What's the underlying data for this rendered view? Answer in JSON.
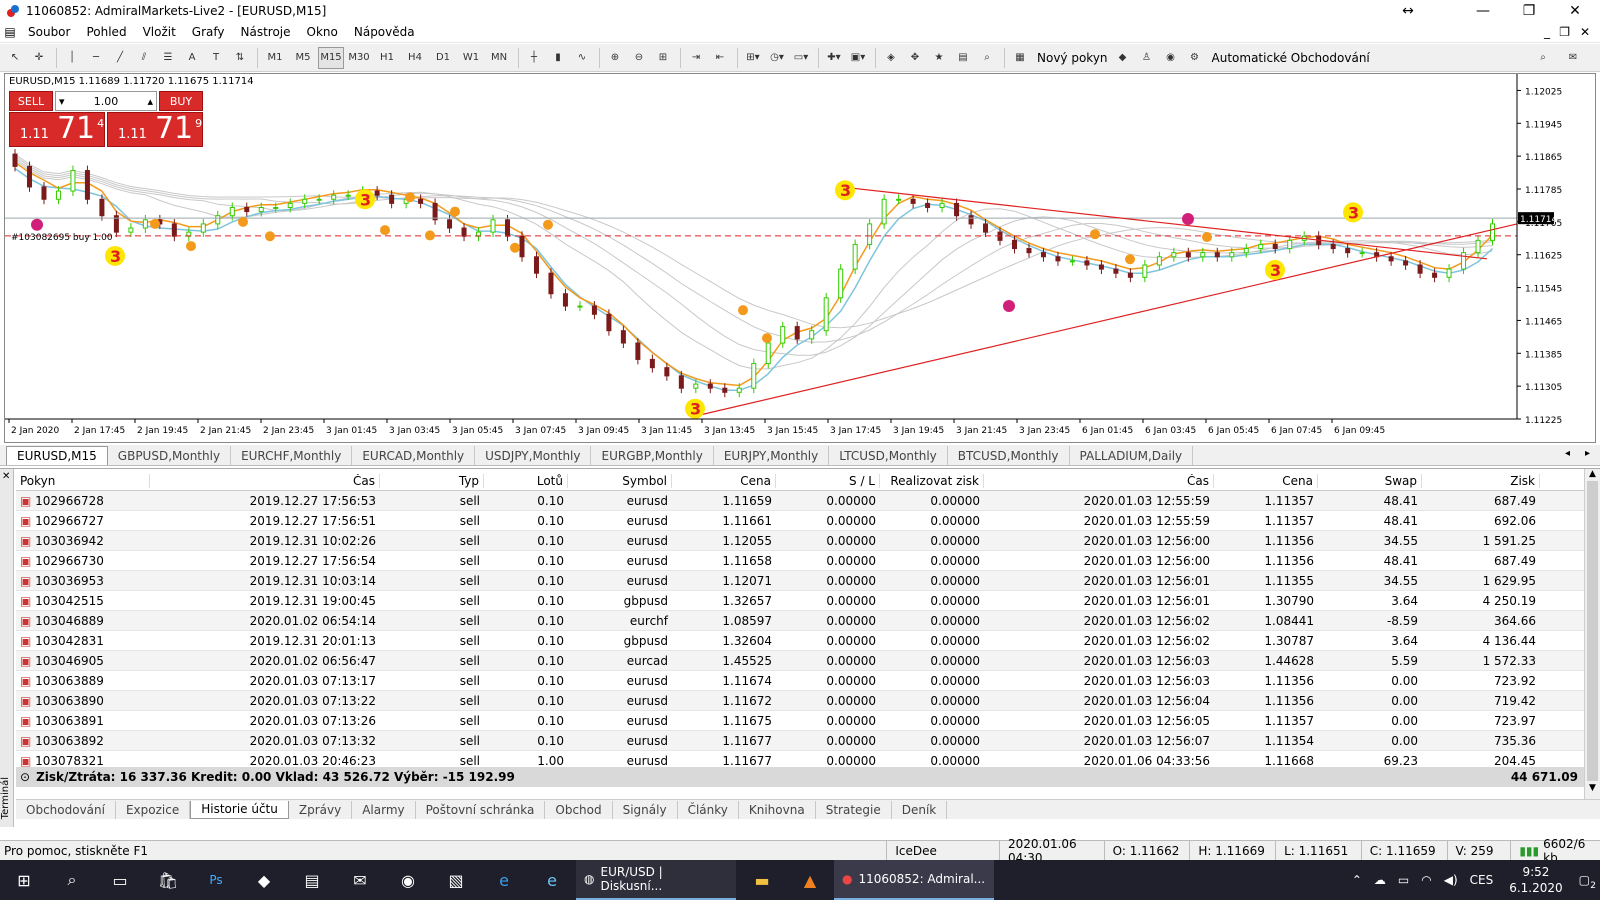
{
  "window": {
    "title": "11060852: AdmiralMarkets-Live2 - [EURUSD,M15]"
  },
  "menu": [
    "Soubor",
    "Pohled",
    "Vložit",
    "Grafy",
    "Nástroje",
    "Okno",
    "Nápověda"
  ],
  "toolbar": {
    "timeframes": [
      "M1",
      "M5",
      "M15",
      "M30",
      "H1",
      "H4",
      "D1",
      "W1",
      "MN"
    ],
    "new_order": "Nový pokyn",
    "auto_trading": "Automatické Obchodování"
  },
  "chart": {
    "info": "EURUSD,M15  1.11689 1.11720 1.11675 1.11714",
    "sell_label": "SELL",
    "buy_label": "BUY",
    "lot": "1.00",
    "sell_price": {
      "small": "1.11",
      "big": "71",
      "sup": "4"
    },
    "buy_price": {
      "small": "1.11",
      "big": "71",
      "sup": "9"
    },
    "order_line_label": "#103082695 buy 1.00",
    "current_price_label": "1.11714",
    "price_levels": [
      "1.12025",
      "1.11945",
      "1.11865",
      "1.11785",
      "1.11705",
      "1.11625",
      "1.11545",
      "1.11465",
      "1.11385",
      "1.11305",
      "1.11225"
    ],
    "time_labels": [
      "2 Jan 2020",
      "2 Jan 17:45",
      "2 Jan 19:45",
      "2 Jan 21:45",
      "2 Jan 23:45",
      "3 Jan 01:45",
      "3 Jan 03:45",
      "3 Jan 05:45",
      "3 Jan 07:45",
      "3 Jan 09:45",
      "3 Jan 11:45",
      "3 Jan 13:45",
      "3 Jan 15:45",
      "3 Jan 17:45",
      "3 Jan 19:45",
      "3 Jan 21:45",
      "3 Jan 23:45",
      "6 Jan 01:45",
      "6 Jan 03:45",
      "6 Jan 05:45",
      "6 Jan 07:45",
      "6 Jan 09:45"
    ]
  },
  "chart_data": {
    "type": "line",
    "ylim": [
      1.11225,
      1.12065
    ],
    "close": [
      1.1184,
      1.1179,
      1.1176,
      1.1178,
      1.1183,
      1.1176,
      1.1172,
      1.1168,
      1.1169,
      1.1171,
      1.117,
      1.1167,
      1.1168,
      1.117,
      1.1172,
      1.1174,
      1.1173,
      1.1174,
      1.1174,
      1.1175,
      1.1176,
      1.1176,
      1.1177,
      1.1177,
      1.1178,
      1.1177,
      1.1175,
      1.1176,
      1.1175,
      1.1171,
      1.1169,
      1.1167,
      1.1168,
      1.1171,
      1.1167,
      1.1162,
      1.1158,
      1.1153,
      1.115,
      1.115,
      1.1148,
      1.1144,
      1.1141,
      1.1137,
      1.1135,
      1.1133,
      1.113,
      1.1131,
      1.113,
      1.1129,
      1.113,
      1.1136,
      1.1141,
      1.1145,
      1.1142,
      1.1144,
      1.1152,
      1.1159,
      1.1165,
      1.117,
      1.1176,
      1.1176,
      1.1175,
      1.1174,
      1.1175,
      1.1172,
      1.117,
      1.1168,
      1.1166,
      1.1164,
      1.1163,
      1.1162,
      1.1161,
      1.1161,
      1.116,
      1.1159,
      1.1158,
      1.1157,
      1.116,
      1.1162,
      1.1163,
      1.1162,
      1.1163,
      1.1162,
      1.1163,
      1.1164,
      1.1165,
      1.1164,
      1.1166,
      1.1167,
      1.1165,
      1.1164,
      1.1163,
      1.1163,
      1.1162,
      1.1161,
      1.116,
      1.1158,
      1.1157,
      1.1159,
      1.1163,
      1.1166,
      1.117
    ],
    "resistance_line": {
      "from": [
        1.1179
      ],
      "to": [
        1.11615
      ]
    },
    "support_line": {
      "from": [
        1.11232
      ],
      "to": [
        1.117
      ]
    }
  },
  "symbol_tabs": [
    "EURUSD,M15",
    "GBPUSD,Monthly",
    "EURCHF,Monthly",
    "EURCAD,Monthly",
    "USDJPY,Monthly",
    "EURGBP,Monthly",
    "EURJPY,Monthly",
    "LTCUSD,Monthly",
    "BTCUSD,Monthly",
    "PALLADIUM,Daily"
  ],
  "history": {
    "columns": [
      "Pokyn",
      "Čas",
      "Typ",
      "Lotů",
      "Symbol",
      "Cena",
      "S / L",
      "Realizovat zisk",
      "Čas",
      "Cena",
      "Swap",
      "Zisk"
    ],
    "rows": [
      [
        "102966728",
        "2019.12.27 17:56:53",
        "sell",
        "0.10",
        "eurusd",
        "1.11659",
        "0.00000",
        "0.00000",
        "2020.01.03 12:55:59",
        "1.11357",
        "48.41",
        "687.49"
      ],
      [
        "102966727",
        "2019.12.27 17:56:51",
        "sell",
        "0.10",
        "eurusd",
        "1.11661",
        "0.00000",
        "0.00000",
        "2020.01.03 12:55:59",
        "1.11357",
        "48.41",
        "692.06"
      ],
      [
        "103036942",
        "2019.12.31 10:02:26",
        "sell",
        "0.10",
        "eurusd",
        "1.12055",
        "0.00000",
        "0.00000",
        "2020.01.03 12:56:00",
        "1.11356",
        "34.55",
        "1 591.25"
      ],
      [
        "102966730",
        "2019.12.27 17:56:54",
        "sell",
        "0.10",
        "eurusd",
        "1.11658",
        "0.00000",
        "0.00000",
        "2020.01.03 12:56:00",
        "1.11356",
        "48.41",
        "687.49"
      ],
      [
        "103036953",
        "2019.12.31 10:03:14",
        "sell",
        "0.10",
        "eurusd",
        "1.12071",
        "0.00000",
        "0.00000",
        "2020.01.03 12:56:01",
        "1.11355",
        "34.55",
        "1 629.95"
      ],
      [
        "103042515",
        "2019.12.31 19:00:45",
        "sell",
        "0.10",
        "gbpusd",
        "1.32657",
        "0.00000",
        "0.00000",
        "2020.01.03 12:56:01",
        "1.30790",
        "3.64",
        "4 250.19"
      ],
      [
        "103046889",
        "2020.01.02 06:54:14",
        "sell",
        "0.10",
        "eurchf",
        "1.08597",
        "0.00000",
        "0.00000",
        "2020.01.03 12:56:02",
        "1.08441",
        "-8.59",
        "364.66"
      ],
      [
        "103042831",
        "2019.12.31 20:01:13",
        "sell",
        "0.10",
        "gbpusd",
        "1.32604",
        "0.00000",
        "0.00000",
        "2020.01.03 12:56:02",
        "1.30787",
        "3.64",
        "4 136.44"
      ],
      [
        "103046905",
        "2020.01.02 06:56:47",
        "sell",
        "0.10",
        "eurcad",
        "1.45525",
        "0.00000",
        "0.00000",
        "2020.01.03 12:56:03",
        "1.44628",
        "5.59",
        "1 572.33"
      ],
      [
        "103063889",
        "2020.01.03 07:13:17",
        "sell",
        "0.10",
        "eurusd",
        "1.11674",
        "0.00000",
        "0.00000",
        "2020.01.03 12:56:03",
        "1.11356",
        "0.00",
        "723.92"
      ],
      [
        "103063890",
        "2020.01.03 07:13:22",
        "sell",
        "0.10",
        "eurusd",
        "1.11672",
        "0.00000",
        "0.00000",
        "2020.01.03 12:56:04",
        "1.11356",
        "0.00",
        "719.42"
      ],
      [
        "103063891",
        "2020.01.03 07:13:26",
        "sell",
        "0.10",
        "eurusd",
        "1.11675",
        "0.00000",
        "0.00000",
        "2020.01.03 12:56:05",
        "1.11357",
        "0.00",
        "723.97"
      ],
      [
        "103063892",
        "2020.01.03 07:13:32",
        "sell",
        "0.10",
        "eurusd",
        "1.11677",
        "0.00000",
        "0.00000",
        "2020.01.03 12:56:07",
        "1.11354",
        "0.00",
        "735.36"
      ],
      [
        "103078321",
        "2020.01.03 20:46:23",
        "sell",
        "1.00",
        "eurusd",
        "1.11677",
        "0.00000",
        "0.00000",
        "2020.01.06 04:33:56",
        "1.11668",
        "69.23",
        "204.45"
      ]
    ],
    "summary": "Zisk/Ztráta: 16 337.36  Kredit: 0.00  Vklad: 43 526.72  Výběr: -15 192.99",
    "total": "44 671.09",
    "side_label": "Terminál"
  },
  "term_tabs": [
    "Obchodování",
    "Expozice",
    "Historie účtu",
    "Zprávy",
    "Alarmy",
    "Poštovní schránka",
    "Obchod",
    "Signály",
    "Články",
    "Knihovna",
    "Strategie",
    "Deník"
  ],
  "status": {
    "help": "Pro pomoc, stiskněte F1",
    "profile": "IceDee",
    "datetime": "2020.01.06 04:30",
    "open": "O: 1.11662",
    "high": "H: 1.11669",
    "low": "L: 1.11651",
    "close": "C: 1.11659",
    "volume": "V: 259",
    "traffic": "6602/6 kb"
  },
  "taskbar": {
    "app1": "EUR/USD | Diskusní...",
    "app2": "11060852: Admiral...",
    "lang": "CES",
    "time": "9:52",
    "date": "6.1.2020",
    "notif": "2"
  },
  "colors": {
    "bull": "#33cc00",
    "bear": "#7a1a1a",
    "trend": "#e02020",
    "ma_fast": "#f39a1c",
    "ma_blue": "#7ec4dd",
    "ma_gray": "#c8c8c8",
    "sell": "#d92a2a"
  }
}
